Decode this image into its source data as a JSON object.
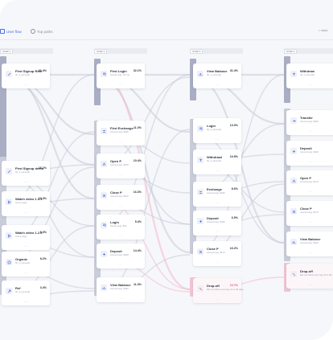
{
  "tabs": [
    {
      "label": "User flow",
      "active": true,
      "icon": "flow-icon"
    },
    {
      "label": "Top paths",
      "active": false,
      "icon": "paths-icon"
    }
  ],
  "steps_control": "< steps",
  "step_headers": [
    "STEP 1",
    "STEP 2",
    "STEP 3",
    "STEP 4"
  ],
  "colors": {
    "accent": "#4b6cf0",
    "dropoff": "#e2557e",
    "bar": "#a9aec4"
  },
  "columns": [
    {
      "step": "STEP 1",
      "nodes": [
        {
          "title": "First Signup Real",
          "sub": "ID_1_Homedit",
          "pct": "61.4%",
          "icon": "signup-icon"
        },
        {
          "title": "First Signup demo",
          "sub": "ID_1_Homedit",
          "pct": "16.1%",
          "icon": "signup-icon"
        },
        {
          "title": "Watch video 1.3.1",
          "sub": "Home page",
          "pct": "10.3%",
          "icon": "video-icon"
        },
        {
          "title": "Watch video 1.2.6",
          "sub": "Home page",
          "pct": "9.3%",
          "icon": "video-icon"
        },
        {
          "title": "Organic",
          "sub": "ID_1_Homedit",
          "pct": "8.2%",
          "icon": "target-icon"
        },
        {
          "title": "Ref",
          "sub": "ID_1_Homedit",
          "pct": "3.4%",
          "icon": "link-icon"
        }
      ]
    },
    {
      "step": "STEP 2",
      "nodes": [
        {
          "title": "First Login",
          "sub": "Screen avg. 10 min",
          "pct": "32.1%",
          "icon": "login-icon"
        },
        {
          "title": "First Exchange",
          "sub": "Amount avg. $340",
          "pct": "11.3%",
          "icon": "exchange-icon"
        },
        {
          "title": "Open P",
          "sub": "Amount avg. $150",
          "pct": "10.4%",
          "icon": "open-icon"
        },
        {
          "title": "Close P",
          "sub": "Amount avg. $110",
          "pct": "16.3%",
          "icon": "close-icon"
        },
        {
          "title": "Login",
          "sub": "Screen avg. $10",
          "pct": "5.4%",
          "icon": "login-icon"
        },
        {
          "title": "Deposit",
          "sub": "Amount avg. $240",
          "pct": "14.4%",
          "icon": "deposit-icon"
        },
        {
          "title": "View Balance",
          "sub": "Amount avg. $340",
          "pct": "11.3%",
          "icon": "balance-icon"
        }
      ]
    },
    {
      "step": "STEP 3",
      "nodes": [
        {
          "title": "View Balance",
          "sub": "ID_1_Homedit",
          "pct": "31.4%",
          "icon": "balance-icon"
        },
        {
          "title": "Login",
          "sub": "ID_1_Homedit",
          "pct": "13.0%",
          "icon": "login-icon"
        },
        {
          "title": "Withdrawl",
          "sub": "ID_1_Homedit",
          "pct": "10.5%",
          "icon": "withdraw-icon"
        },
        {
          "title": "Exchange",
          "sub": "Amount avg. $340",
          "pct": "8.6%",
          "icon": "exchange-icon"
        },
        {
          "title": "Deposit",
          "sub": "Amount avg. $340",
          "pct": "6.5%",
          "icon": "deposit-icon"
        },
        {
          "title": "Close P",
          "sub": "Amount avg. $170",
          "pct": "16.2%",
          "icon": "close-icon"
        },
        {
          "title": "Drop-off",
          "sub": "Did not follow next step from 30 days",
          "pct": "10.7%",
          "icon": "dropoff-icon",
          "drop": true
        }
      ]
    },
    {
      "step": "STEP 4",
      "nodes": [
        {
          "title": "Withdraw",
          "sub": "ID_1_Homedit",
          "pct": "",
          "icon": "withdraw-icon"
        },
        {
          "title": "Transfer",
          "sub": "Amount avg. $340",
          "pct": "",
          "icon": "transfer-icon"
        },
        {
          "title": "Deposit",
          "sub": "Amount avg. $340",
          "pct": "",
          "icon": "deposit-icon"
        },
        {
          "title": "Open P",
          "sub": "Amount avg. $110",
          "pct": "",
          "icon": "open-icon"
        },
        {
          "title": "Close P",
          "sub": "Amount avg. $170",
          "pct": "",
          "icon": "close-icon"
        },
        {
          "title": "View Balance",
          "sub": "Amount avg. $340",
          "pct": "",
          "icon": "balance-icon"
        },
        {
          "title": "Drop-off",
          "sub": "Did not follow next step from 30 days",
          "pct": "",
          "icon": "dropoff-icon",
          "drop": true
        }
      ]
    }
  ]
}
